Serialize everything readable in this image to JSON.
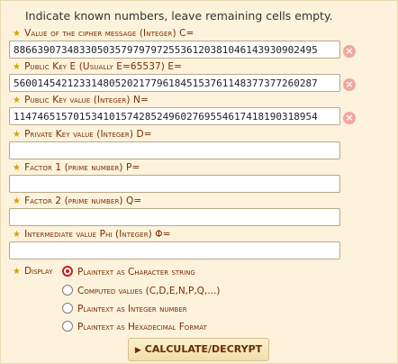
{
  "intro": "Indicate known numbers, leave remaining cells empty.",
  "fields": [
    {
      "label": "Value of the cipher message (Integer) C=",
      "value": "886639073483305035797979725536120381046143930902495",
      "has_clear": true
    },
    {
      "label": "Public Key E (Usually E=65537) E=",
      "value": "560014542123314805202177961845153761148377377260287",
      "has_clear": true
    },
    {
      "label": "Public Key value (Integer) N=",
      "value": "114746515701534101574285249602769554617418190318954",
      "has_clear": true
    },
    {
      "label": "Private Key value (Integer) D=",
      "value": "",
      "has_clear": false
    },
    {
      "label": "Factor 1 (prime number) P=",
      "value": "",
      "has_clear": false
    },
    {
      "label": "Factor 2 (prime number) Q=",
      "value": "",
      "has_clear": false
    },
    {
      "label": "Intermediate value Phi (Integer) Φ=",
      "value": "",
      "has_clear": false
    }
  ],
  "clear_glyph": "×",
  "display": {
    "label": "Display",
    "options": [
      {
        "label": "Plaintext as Character string",
        "checked": true
      },
      {
        "label": "Computed values (C,D,E,N,P,Q,...)",
        "checked": false
      },
      {
        "label": "Plaintext as Integer number",
        "checked": false
      },
      {
        "label": "Plaintext as Hexadecimal Format",
        "checked": false
      }
    ]
  },
  "button": {
    "label": "CALCULATE/DECRYPT",
    "icon": "play-icon"
  },
  "colors": {
    "background": "#fdf3dc",
    "label": "#7a2a00",
    "star": "#d8a000",
    "radio_selected": "#c81b1b",
    "clear": "#f2a6a0"
  }
}
